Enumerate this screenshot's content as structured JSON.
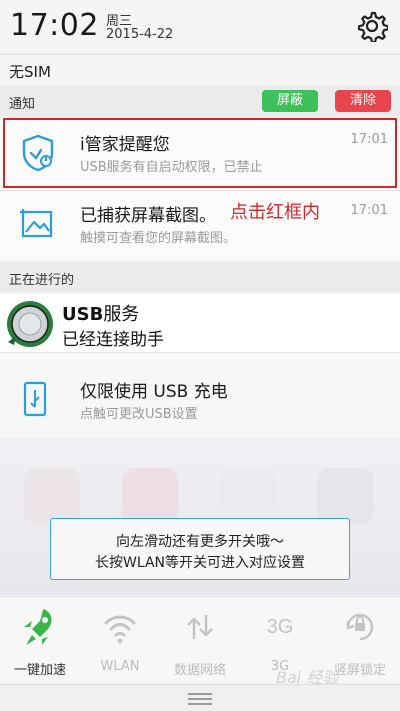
{
  "status": {
    "time": "17:02",
    "weekday": "周三",
    "date": "2015-4-22",
    "settings_icon": "gear-icon"
  },
  "sim": {
    "label": "无SIM"
  },
  "notifications": {
    "header": "通知",
    "block_label": "屏蔽",
    "clear_label": "清除",
    "block_color": "#3dbf59",
    "clear_color": "#e8454f",
    "items": [
      {
        "icon": "shield-power-icon",
        "title": "i管家提醒您",
        "subtitle": "USB服务有自启动权限，已禁止",
        "time": "17:01"
      },
      {
        "icon": "screenshot-icon",
        "title": "已捕获屏幕截图。",
        "subtitle": "触摸可查看您的屏幕截图。",
        "time": "17:01"
      }
    ]
  },
  "annotation": {
    "text": "点击红框内",
    "color": "#d3262b"
  },
  "ongoing": {
    "header": "正在进行的",
    "usb_service": {
      "title_en": "USB",
      "title_cn": "服务",
      "subtitle": "已经连接助手"
    },
    "usb_charge": {
      "icon": "usb-icon",
      "title": "仅限使用 USB 充电",
      "subtitle": "点触可更改USB设置"
    }
  },
  "tip": {
    "line1": "向左滑动还有更多开关哦～",
    "line2": "长按WLAN等开关可进入对应设置"
  },
  "toggles": [
    {
      "icon": "rocket-icon",
      "label": "一键加速",
      "active": true
    },
    {
      "icon": "wifi-icon",
      "label": "WLAN",
      "active": false
    },
    {
      "icon": "data-network-icon",
      "label": "数据网络",
      "active": false
    },
    {
      "icon": "3g-icon",
      "label": "3G",
      "active": false
    },
    {
      "icon": "rotation-lock-icon",
      "label": "竖屏锁定",
      "active": false
    }
  ],
  "watermark": "Bai 经验"
}
